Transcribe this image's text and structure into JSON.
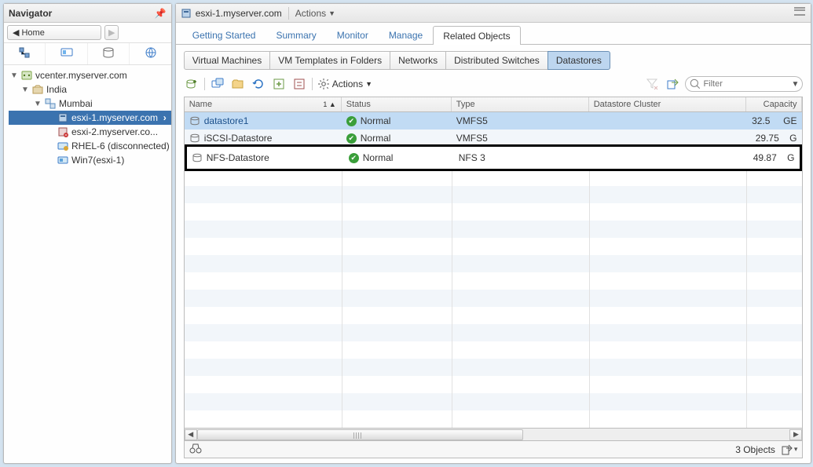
{
  "navigator": {
    "title": "Navigator",
    "breadcrumb": {
      "back_label": "Home"
    },
    "tree": {
      "vcenter": "vcenter.myserver.com",
      "datacenter": "India",
      "cluster": "Mumbai",
      "host1": "esxi-1.myserver.com",
      "host2": "esxi-2.myserver.co...",
      "vm1": "RHEL-6 (disconnected)",
      "vm2": "Win7(esxi-1)"
    }
  },
  "main": {
    "title": "esxi-1.myserver.com",
    "actions_label": "Actions",
    "top_tabs": [
      "Getting Started",
      "Summary",
      "Monitor",
      "Manage",
      "Related Objects"
    ],
    "sub_tabs": [
      "Virtual Machines",
      "VM Templates in Folders",
      "Networks",
      "Distributed Switches",
      "Datastores"
    ],
    "toolbar": {
      "actions_label": "Actions",
      "filter_placeholder": "Filter"
    },
    "columns": {
      "name": "Name",
      "status": "Status",
      "type": "Type",
      "cluster": "Datastore Cluster",
      "capacity": "Capacity",
      "sort": "1 ▲"
    },
    "rows": [
      {
        "name": "datastore1",
        "status": "Normal",
        "type": "VMFS5",
        "cluster": "",
        "capacity": "32.5",
        "unit": "GE"
      },
      {
        "name": "iSCSI-Datastore",
        "status": "Normal",
        "type": "VMFS5",
        "cluster": "",
        "capacity": "29.75",
        "unit": "G"
      },
      {
        "name": "NFS-Datastore",
        "status": "Normal",
        "type": "NFS 3",
        "cluster": "",
        "capacity": "49.87",
        "unit": "G"
      }
    ],
    "footer": {
      "count_label": "3 Objects"
    }
  }
}
